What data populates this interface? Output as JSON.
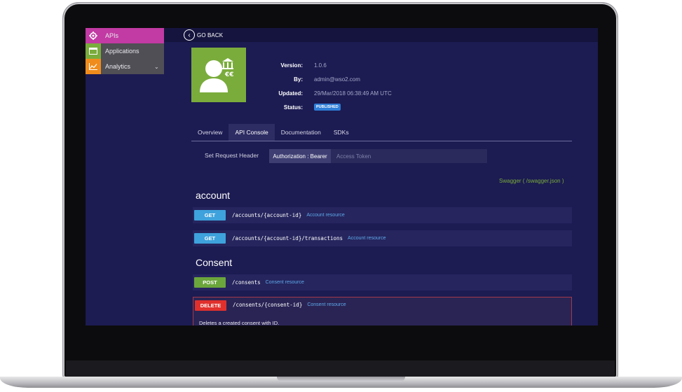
{
  "sidebar": {
    "items": [
      {
        "label": "APIs",
        "icon": "gear-icon",
        "active": true
      },
      {
        "label": "Applications",
        "icon": "window-icon",
        "active": false
      },
      {
        "label": "Analytics",
        "icon": "chart-icon",
        "active": false
      }
    ]
  },
  "topbar": {
    "back_label": "GO BACK"
  },
  "api": {
    "version_label": "Version:",
    "version": "1.0.6",
    "by_label": "By:",
    "by": "admin@wso2.com",
    "updated_label": "Updated:",
    "updated": "29/Mar/2018 06:38:49 AM UTC",
    "status_label": "Status:",
    "status": "PUBLISHED"
  },
  "tabs": [
    "Overview",
    "API Console",
    "Documentation",
    "SDKs"
  ],
  "active_tab": "API Console",
  "request_header": {
    "label": "Set Request Header",
    "auth_label": "Authorization : Bearer",
    "token_placeholder": "Access Token"
  },
  "swagger_link": "Swagger ( /swagger.json )",
  "sections": [
    {
      "title": "account",
      "endpoints": [
        {
          "method": "GET",
          "path": "/accounts/{account-id}",
          "desc": "Account resource"
        },
        {
          "method": "GET",
          "path": "/accounts/{account-id}/transactions",
          "desc": "Account resource"
        }
      ]
    },
    {
      "title": "Consent",
      "endpoints": [
        {
          "method": "POST",
          "path": "/consents",
          "desc": "Consent resource"
        },
        {
          "method": "DELETE",
          "path": "/consents/{consent-id}",
          "desc": "Consent resource",
          "note": "Deletes a created consent with ID."
        }
      ]
    }
  ],
  "colors": {
    "accent": "#c23aa3",
    "background": "#1c1b52",
    "get": "#3ea2dc",
    "post": "#6ba63c",
    "delete": "#e0302d",
    "logo": "#7aac3c"
  }
}
